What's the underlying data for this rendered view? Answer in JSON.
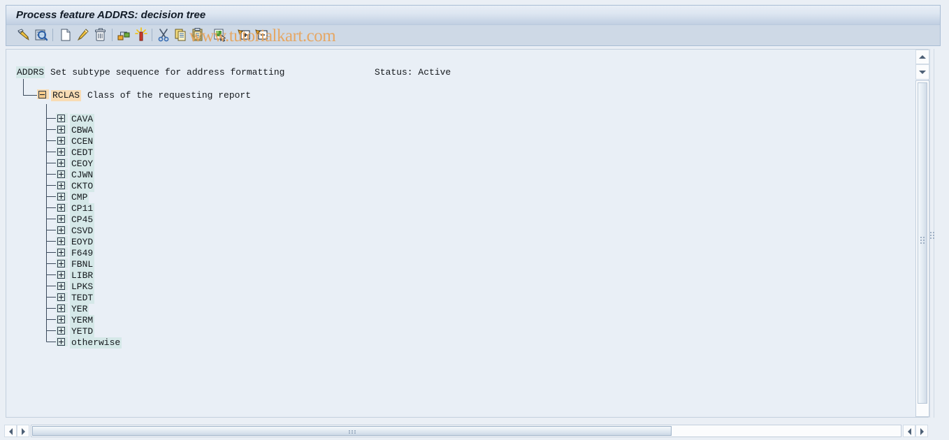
{
  "window": {
    "title": "Process feature ADDRS: decision tree"
  },
  "toolbar": {
    "buttons": [
      {
        "name": "check-pencil-icon",
        "tooltip": "Check"
      },
      {
        "name": "display-magnifier-icon",
        "tooltip": "Display"
      },
      {
        "name": "create-page-icon",
        "tooltip": "Create"
      },
      {
        "name": "change-pencil-icon",
        "tooltip": "Change"
      },
      {
        "name": "delete-trash-icon",
        "tooltip": "Delete"
      },
      {
        "name": "node-structure-icon",
        "tooltip": "Structure"
      },
      {
        "name": "new-sparkle-icon",
        "tooltip": "New Entry"
      },
      {
        "name": "cut-scissors-icon",
        "tooltip": "Cut"
      },
      {
        "name": "copy-icon",
        "tooltip": "Copy"
      },
      {
        "name": "paste-clipboard-icon",
        "tooltip": "Paste"
      },
      {
        "name": "select-node-icon",
        "tooltip": "Select"
      },
      {
        "name": "expand-node-icon",
        "tooltip": "Expand"
      },
      {
        "name": "collapse-node-icon",
        "tooltip": "Collapse"
      }
    ]
  },
  "watermark": {
    "text": "www.tutorialkart.com",
    "color": "#e8a35a"
  },
  "tree": {
    "root": {
      "code": "ADDRS",
      "description": "Set subtype sequence for address formatting",
      "status_label": "Status: Active",
      "code_highlight": "#d5e8e8"
    },
    "branch": {
      "code": "RCLAS",
      "description": "Class of the requesting report",
      "expanded": true,
      "code_highlight": "#f8dcb4"
    },
    "children": [
      {
        "label": "CAVA",
        "expanded": false
      },
      {
        "label": "CBWA",
        "expanded": false
      },
      {
        "label": "CCEN",
        "expanded": false
      },
      {
        "label": "CEDT",
        "expanded": false
      },
      {
        "label": "CEOY",
        "expanded": false
      },
      {
        "label": "CJWN",
        "expanded": false
      },
      {
        "label": "CKTO",
        "expanded": false
      },
      {
        "label": "CMP",
        "expanded": false
      },
      {
        "label": "CP11",
        "expanded": false
      },
      {
        "label": "CP45",
        "expanded": false
      },
      {
        "label": "CSVD",
        "expanded": false
      },
      {
        "label": "EOYD",
        "expanded": false
      },
      {
        "label": "F649",
        "expanded": false
      },
      {
        "label": "FBNL",
        "expanded": false
      },
      {
        "label": "LIBR",
        "expanded": false
      },
      {
        "label": "LPKS",
        "expanded": false
      },
      {
        "label": "TEDT",
        "expanded": false
      },
      {
        "label": "YER",
        "expanded": false
      },
      {
        "label": "YERM",
        "expanded": false
      },
      {
        "label": "YETD",
        "expanded": false
      },
      {
        "label": "otherwise",
        "expanded": false
      }
    ]
  },
  "scrollbars": {
    "vertical_top": {
      "up": "▲",
      "down": "▼"
    },
    "vertical_bottom": {
      "up": "▲",
      "down": "▼"
    },
    "horizontal_left": {
      "left": "◀",
      "right": "▶"
    },
    "horizontal_right": {
      "left": "◀",
      "right": "▶"
    }
  }
}
